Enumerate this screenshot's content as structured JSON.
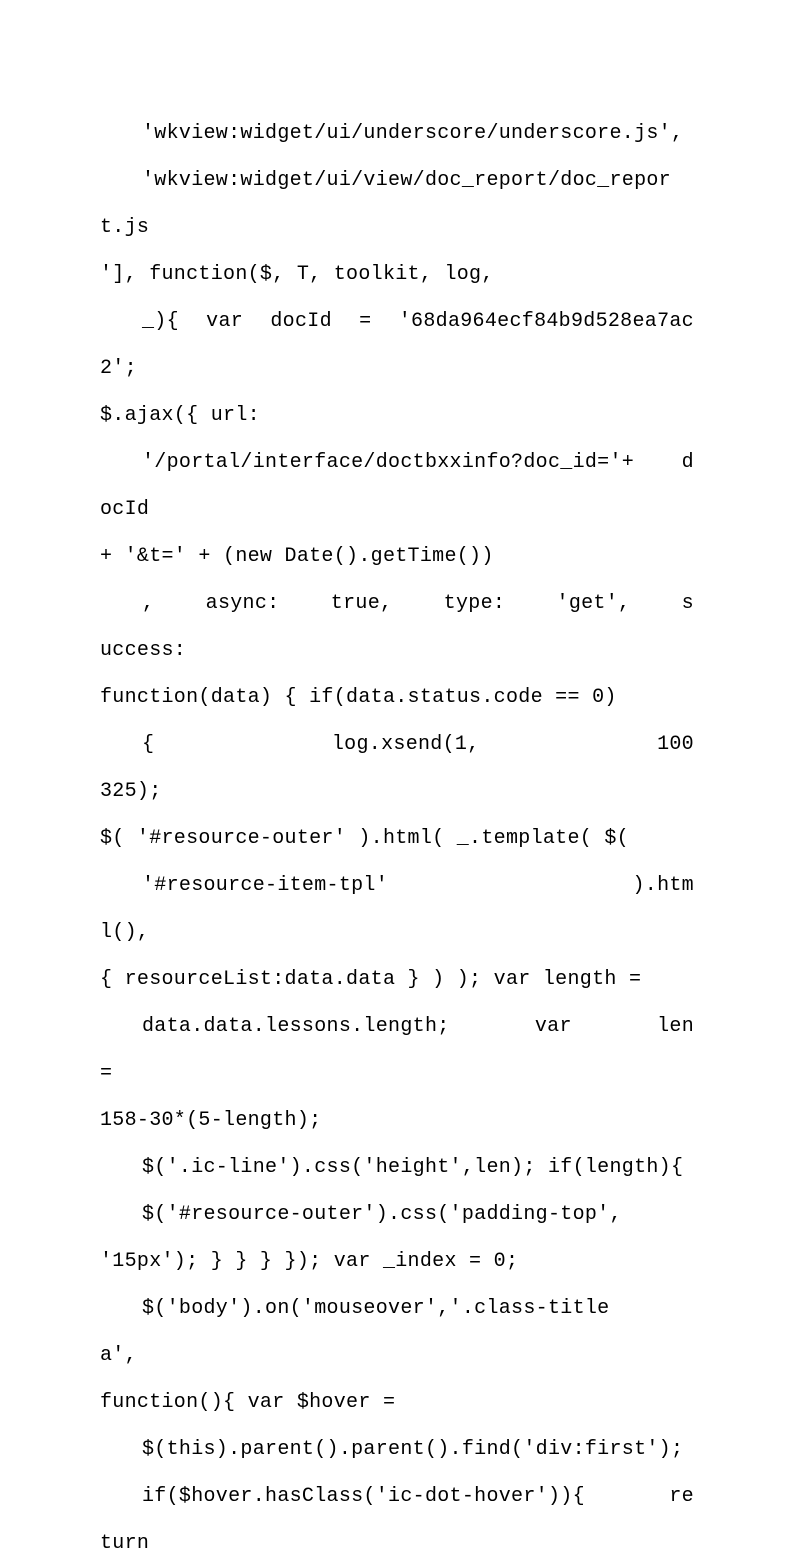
{
  "lines": [
    {
      "cls": "line indent",
      "text": "'wkview:widget/ui/underscore/underscore.js',"
    },
    {
      "cls": "line indent left",
      "text": "'wkview:widget/ui/view/doc_report/doc_report.js"
    },
    {
      "cls": "line left",
      "text": "'], function($, T, toolkit, log,"
    },
    {
      "cls": "line indent",
      "text": "_){  var  docId  =  '68da964ecf84b9d528ea7ac2';"
    },
    {
      "cls": "line left",
      "text": "$.ajax({ url:"
    },
    {
      "cls": "line indent",
      "text": "'/portal/interface/doctbxxinfo?doc_id='+   docId"
    },
    {
      "cls": "line left",
      "text": "+ '&t=' + (new Date().getTime())"
    },
    {
      "cls": "line indent",
      "text": ",    async:    true,    type:    'get',    success:"
    },
    {
      "cls": "line left",
      "text": "function(data) { if(data.status.code == 0)"
    },
    {
      "cls": "line indent",
      "text": "{              log.xsend(1,              100325);"
    },
    {
      "cls": "line left",
      "text": "$( '#resource-outer' ).html( _.template( $("
    },
    {
      "cls": "line indent",
      "text": "'#resource-item-tpl'                   ).html(),"
    },
    {
      "cls": "line left",
      "text": "{ resourceList:data.data } ) ); var length ="
    },
    {
      "cls": "line indent",
      "text": "data.data.lessons.length;      var      len      ="
    },
    {
      "cls": "line left",
      "text": "158-30*(5-length);"
    },
    {
      "cls": "line indent left",
      "text": "$('.ic-line').css('height',len); if(length){"
    },
    {
      "cls": "line indent left",
      "text": "$('#resource-outer').css('padding-top',"
    },
    {
      "cls": "line left",
      "text": "'15px'); } } } }); var _index = 0;"
    },
    {
      "cls": "line indent",
      "text": "$('body').on('mouseover','.class-title       a',"
    },
    {
      "cls": "line left",
      "text": "function(){ var $hover ="
    },
    {
      "cls": "line indent left",
      "text": "$(this).parent().parent().find('div:first');"
    },
    {
      "cls": "line indent",
      "text": "if($hover.hasClass('ic-dot-hover')){      return"
    }
  ]
}
